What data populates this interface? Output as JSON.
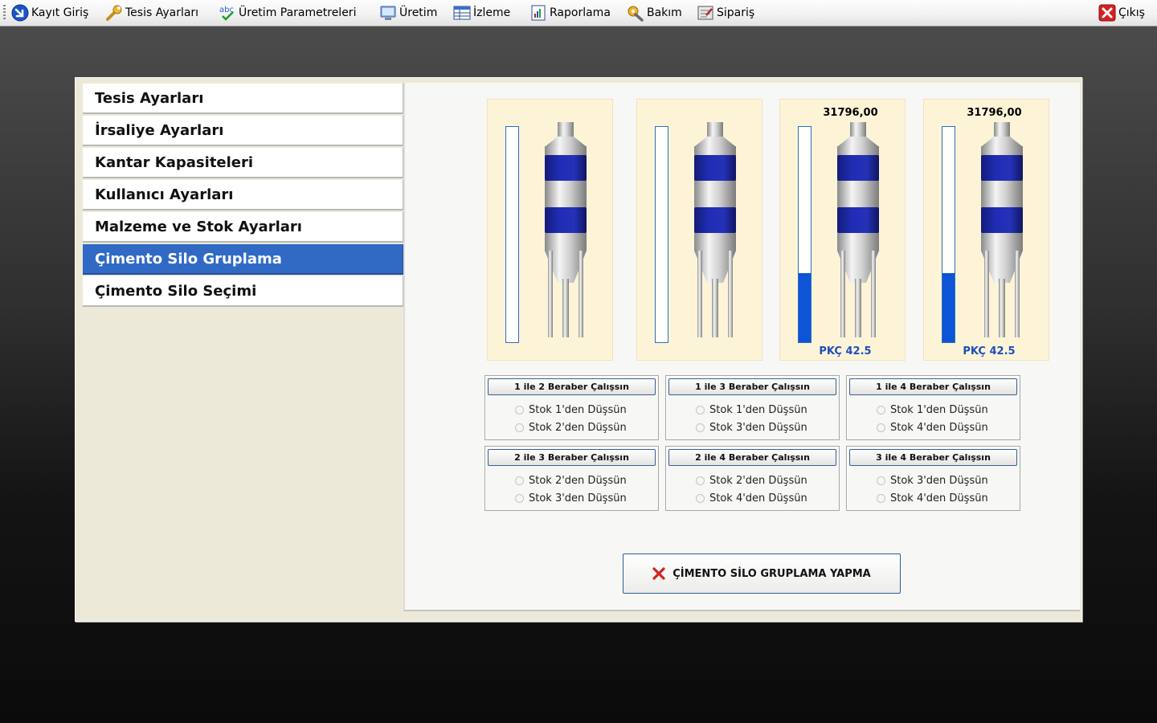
{
  "menu": {
    "items": [
      {
        "label": "Kayıt Giriş",
        "icon": "login-arrow-icon"
      },
      {
        "label": "Tesis Ayarları",
        "icon": "wrench-icon"
      },
      {
        "label": "Üretim Parametreleri",
        "icon": "abc-check-icon"
      },
      {
        "label": "Üretim",
        "icon": "monitor-icon"
      },
      {
        "label": "İzleme",
        "icon": "table-icon"
      },
      {
        "label": "Raporlama",
        "icon": "report-icon"
      },
      {
        "label": "Bakım",
        "icon": "tools-icon"
      },
      {
        "label": "Sipariş",
        "icon": "order-icon"
      }
    ],
    "exit_label": "Çıkış",
    "exit_icon": "close-icon"
  },
  "nav": {
    "items": [
      {
        "label": "Tesis Ayarları",
        "active": false
      },
      {
        "label": "İrsaliye Ayarları",
        "active": false
      },
      {
        "label": "Kantar Kapasiteleri",
        "active": false
      },
      {
        "label": "Kullanıcı Ayarları",
        "active": false
      },
      {
        "label": "Malzeme ve Stok Ayarları",
        "active": false
      },
      {
        "label": "Çimento Silo Gruplama",
        "active": true
      },
      {
        "label": "Çimento Silo Seçimi",
        "active": false
      }
    ]
  },
  "silos": [
    {
      "value": "",
      "material": "",
      "level_percent": 0
    },
    {
      "value": "",
      "material": "",
      "level_percent": 0
    },
    {
      "value": "31796,00",
      "material": "PKÇ 42.5",
      "level_percent": 32
    },
    {
      "value": "31796,00",
      "material": "PKÇ 42.5",
      "level_percent": 32
    }
  ],
  "groups": [
    {
      "button": "1 ile 2 Beraber Çalışsın",
      "options": [
        "Stok 1'den Düşsün",
        "Stok 2'den Düşsün"
      ]
    },
    {
      "button": "1 ile 3 Beraber Çalışsın",
      "options": [
        "Stok 1'den Düşsün",
        "Stok 3'den Düşsün"
      ]
    },
    {
      "button": "1 ile 4 Beraber Çalışsın",
      "options": [
        "Stok 1'den Düşsün",
        "Stok 4'den Düşsün"
      ]
    },
    {
      "button": "2 ile 3 Beraber Çalışsın",
      "options": [
        "Stok 2'den Düşsün",
        "Stok 3'den Düşsün"
      ]
    },
    {
      "button": "2 ile 4 Beraber Çalışsın",
      "options": [
        "Stok 2'den Düşsün",
        "Stok 4'den Düşsün"
      ]
    },
    {
      "button": "3 ile 4 Beraber Çalışsın",
      "options": [
        "Stok 3'den Düşsün",
        "Stok 4'den Düşsün"
      ]
    }
  ],
  "no_group_button": "ÇİMENTO SİLO GRUPLAMA YAPMA",
  "colors": {
    "accent": "#316ac5",
    "silo_band": "#1f2db5",
    "gauge_fill": "#0d55d6",
    "silo_panel_bg": "#fdf4d8",
    "material_text": "#1d4fbb",
    "close_red": "#d42020"
  }
}
